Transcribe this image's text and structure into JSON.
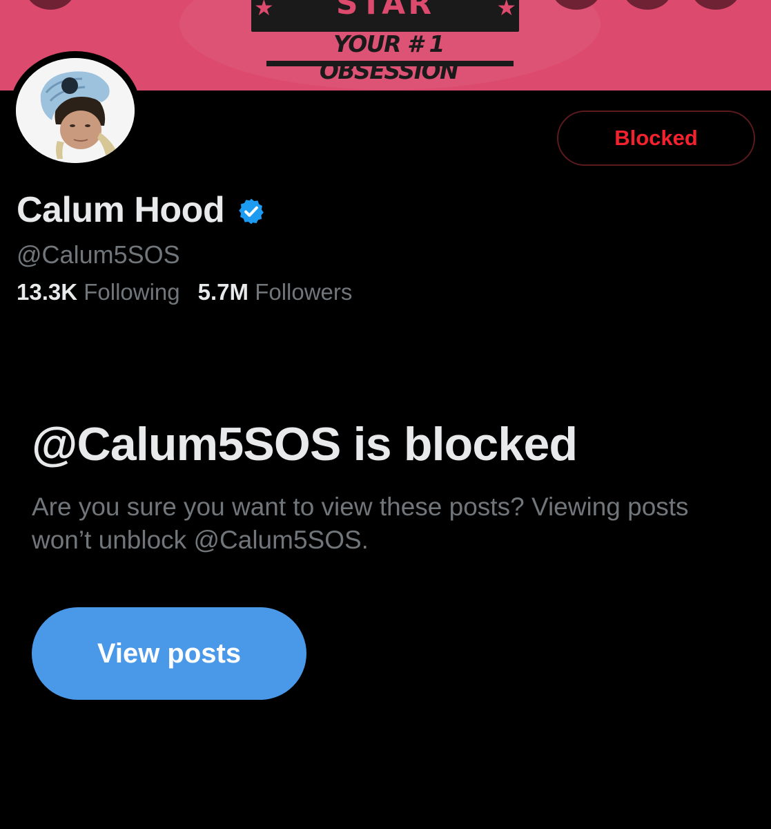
{
  "banner": {
    "logo_text": "STAR",
    "tagline": "YOUR # 1 OBSESSION"
  },
  "profile": {
    "name": "Calum Hood",
    "handle": "@Calum5SOS",
    "verified": true,
    "following_count": "13.3K",
    "following_label": "Following",
    "followers_count": "5.7M",
    "followers_label": "Followers",
    "avatar_icon": "profile-photo"
  },
  "actions": {
    "blocked_label": "Blocked",
    "view_posts_label": "View posts"
  },
  "blocked_notice": {
    "title": "@Calum5SOS is blocked",
    "description": "Are you sure you want to view these posts? Viewing posts won’t unblock @Calum5SOS."
  },
  "colors": {
    "banner": "#dc4a6e",
    "accent_blue": "#4a99e9",
    "blocked_red": "#f4212e",
    "muted_text": "#71767b"
  }
}
